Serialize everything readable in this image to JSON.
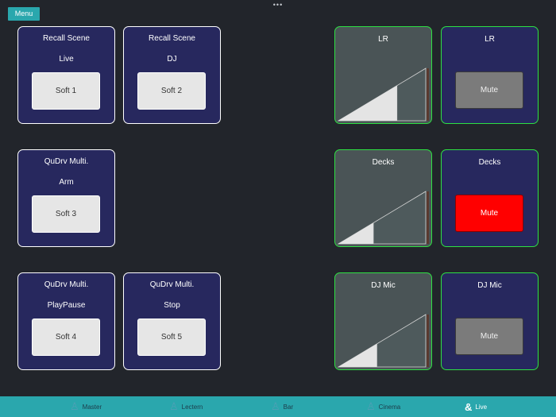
{
  "menu": {
    "label": "Menu"
  },
  "handle": {
    "glyph": "•••"
  },
  "soft_cards": [
    {
      "line1": "Recall Scene",
      "line2": "Live",
      "button": "Soft 1"
    },
    {
      "line1": "Recall Scene",
      "line2": "DJ",
      "button": "Soft 2"
    },
    {
      "line1": "QuDrv Multi.",
      "line2": "Arm",
      "button": "Soft 3"
    },
    {
      "line1": "QuDrv Multi.",
      "line2": "PlayPause",
      "button": "Soft 4"
    },
    {
      "line1": "QuDrv Multi.",
      "line2": "Stop",
      "button": "Soft 5"
    }
  ],
  "channels": [
    {
      "name": "LR",
      "fader_level": 0.67,
      "mute_label": "Mute",
      "muted": false
    },
    {
      "name": "Decks",
      "fader_level": 0.4,
      "mute_label": "Mute",
      "muted": true
    },
    {
      "name": "DJ Mic",
      "fader_level": 0.44,
      "mute_label": "Mute",
      "muted": false
    }
  ],
  "tabs": [
    {
      "label": "Master",
      "icon": "person-icon",
      "active": false
    },
    {
      "label": "Lectern",
      "icon": "person-icon",
      "active": false
    },
    {
      "label": "Bar",
      "icon": "person-icon",
      "active": false
    },
    {
      "label": "Cinema",
      "icon": "person-icon",
      "active": false
    },
    {
      "label": "Live",
      "icon": "ampersand-icon",
      "active": true
    }
  ],
  "colors": {
    "accent": "#2aa7ad",
    "card_bg": "#27285e",
    "fader_border": "#2ee043",
    "mute_on": "#ff0000"
  }
}
